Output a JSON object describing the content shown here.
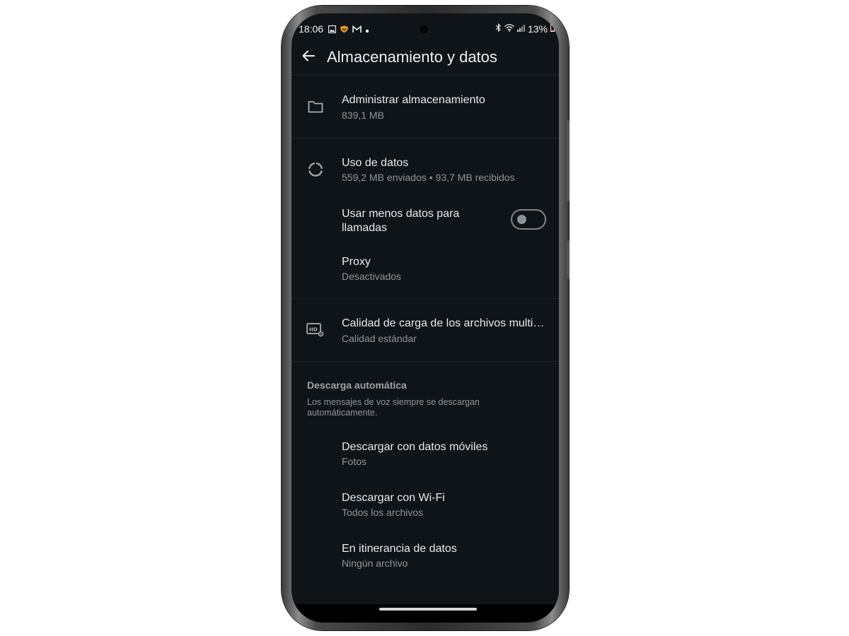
{
  "statusbar": {
    "time": "18:06",
    "battery": "13%",
    "left_icons": [
      "image-icon",
      "shield-heart-icon",
      "gmail-icon",
      "dot-icon"
    ],
    "right_icons": [
      "bluetooth-icon",
      "wifi-icon",
      "signal-icon",
      "battery-icon"
    ]
  },
  "appbar": {
    "title": "Almacenamiento y datos",
    "back_icon": "arrow-left-icon"
  },
  "items": {
    "manage_storage": {
      "title": "Administrar almacenamiento",
      "subtitle": "839,1 MB",
      "icon": "folder-icon"
    },
    "data_usage": {
      "title": "Uso de datos",
      "subtitle": "559,2 MB enviados • 93,7 MB recibidos",
      "icon": "data-usage-icon"
    },
    "less_data_calls": {
      "title_line1": "Usar menos datos para",
      "title_line2": "llamadas",
      "toggle_on": false
    },
    "proxy": {
      "title": "Proxy",
      "subtitle": "Desactivados"
    },
    "media_quality": {
      "title": "Calidad de carga de los archivos multi…",
      "subtitle": "Calidad estándar",
      "icon": "hd-settings-icon"
    }
  },
  "auto_download": {
    "header": "Descarga automática",
    "note": "Los mensajes de voz siempre se descargan automáticamente.",
    "mobile": {
      "title": "Descargar con datos móviles",
      "subtitle": "Fotos"
    },
    "wifi": {
      "title": "Descargar con Wi-Fi",
      "subtitle": "Todos los archivos"
    },
    "roaming": {
      "title": "En itinerancia de datos",
      "subtitle": "Ningún archivo"
    }
  },
  "colors": {
    "background": "#0f1418",
    "text_primary": "#e9ebed",
    "text_secondary": "#8d969e",
    "divider": "#1e252b"
  }
}
